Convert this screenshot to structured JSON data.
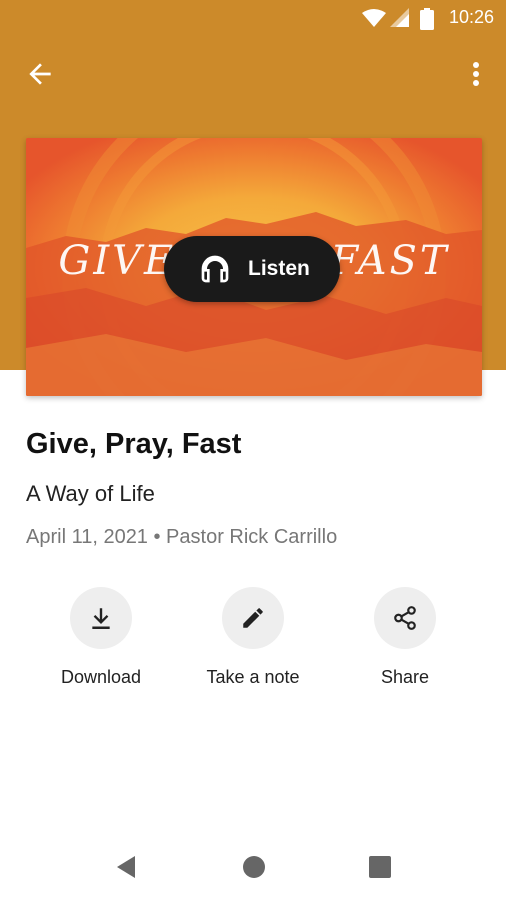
{
  "status_bar": {
    "time": "10:26",
    "icons": [
      "wifi-icon",
      "signal-icon",
      "battery-icon"
    ]
  },
  "toolbar": {
    "back_icon": "arrow-left-icon",
    "menu_icon": "more-vertical-icon"
  },
  "artwork": {
    "title_text": "GIVE PRAY FAST",
    "subtitle_text": "A WAY OF LIFE",
    "listen_label": "Listen",
    "listen_icon": "headphones-icon"
  },
  "sermon": {
    "title": "Give, Pray, Fast",
    "series": "A Way of Life",
    "meta": "April 11, 2021 • Pastor Rick Carrillo"
  },
  "actions": [
    {
      "label": "Download",
      "icon": "download-icon"
    },
    {
      "label": "Take a note",
      "icon": "pencil-icon"
    },
    {
      "label": "Share",
      "icon": "share-icon"
    }
  ],
  "nav_bar": {
    "icons": [
      "nav-back-icon",
      "nav-home-icon",
      "nav-recents-icon"
    ]
  },
  "colors": {
    "header": "#cc8a2a",
    "artwork_orange": "#e8662e",
    "artwork_sun": "#f4a93a",
    "pill": "#1a1a1a"
  }
}
